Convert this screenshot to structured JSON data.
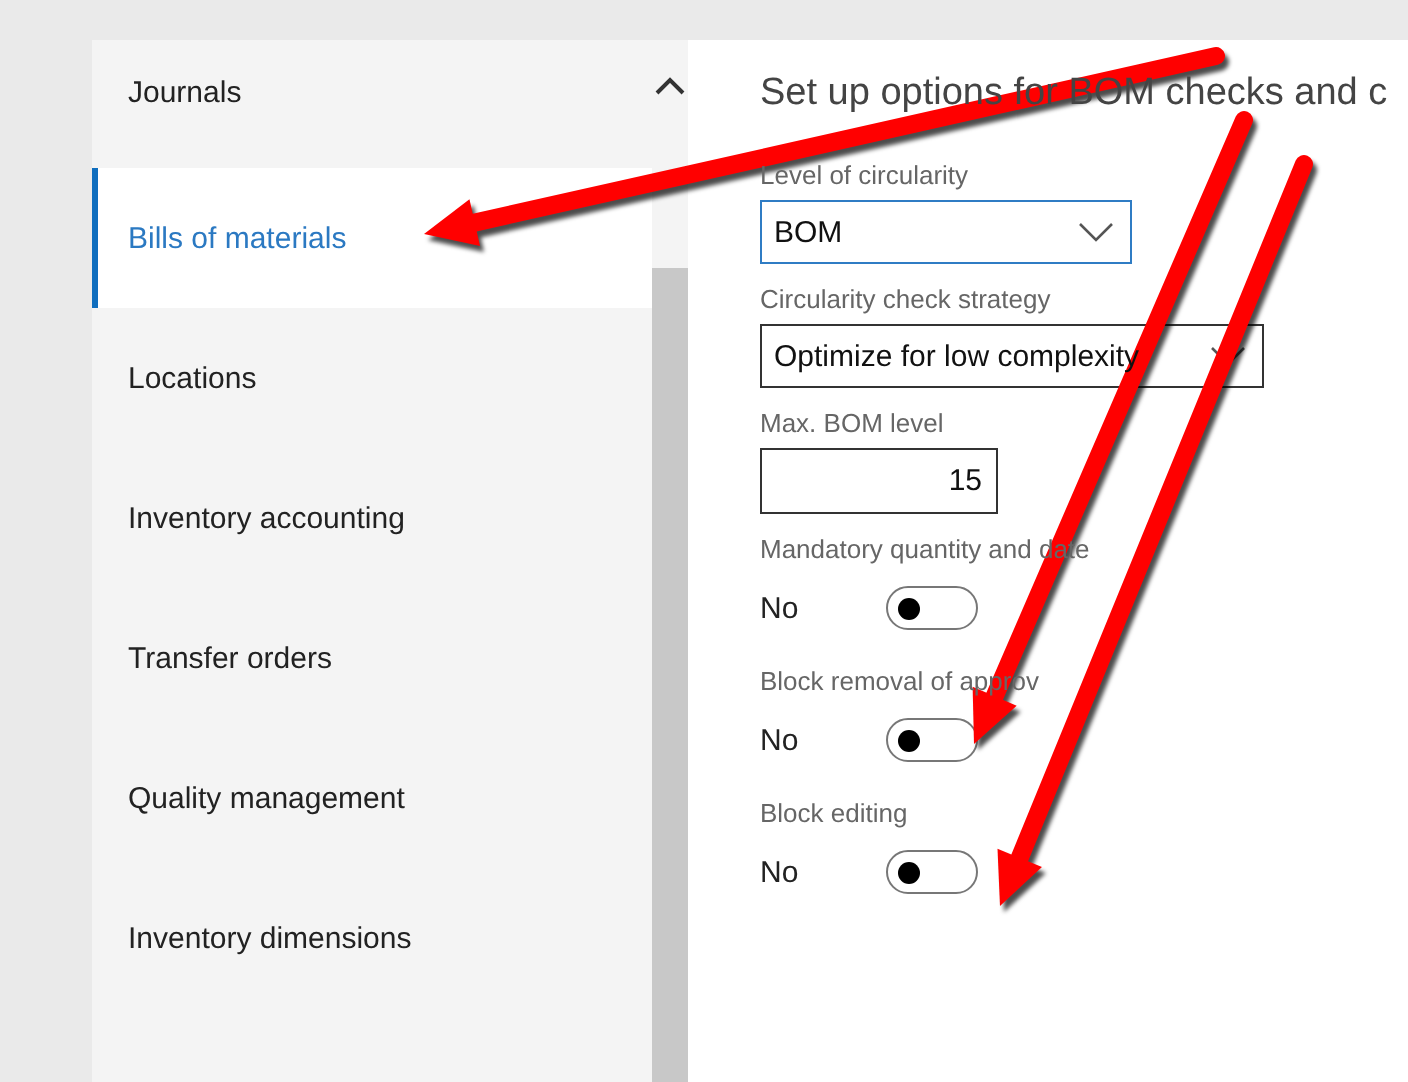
{
  "sidebar": {
    "items": [
      {
        "label": "Journals",
        "selected": false
      },
      {
        "label": "Bills of materials",
        "selected": true
      },
      {
        "label": "Locations",
        "selected": false
      },
      {
        "label": "Inventory accounting",
        "selected": false
      },
      {
        "label": "Transfer orders",
        "selected": false
      },
      {
        "label": "Quality management",
        "selected": false
      },
      {
        "label": "Inventory dimensions",
        "selected": false
      }
    ]
  },
  "main": {
    "heading": "Set up options for BOM checks and c",
    "fields": [
      {
        "kind": "select",
        "label": "Level of circularity",
        "value": "BOM",
        "focused": true
      },
      {
        "kind": "select",
        "label": "Circularity check strategy",
        "value": "Optimize for low complexity",
        "focused": false
      },
      {
        "kind": "number",
        "label": "Max. BOM level",
        "value": "15"
      },
      {
        "kind": "toggle",
        "label": "Mandatory quantity and date",
        "value": "No",
        "on": false
      },
      {
        "kind": "toggle",
        "label": "Block removal of approv",
        "value": "No",
        "on": false
      },
      {
        "kind": "toggle",
        "label": "Block editing",
        "value": "No",
        "on": false
      }
    ]
  }
}
